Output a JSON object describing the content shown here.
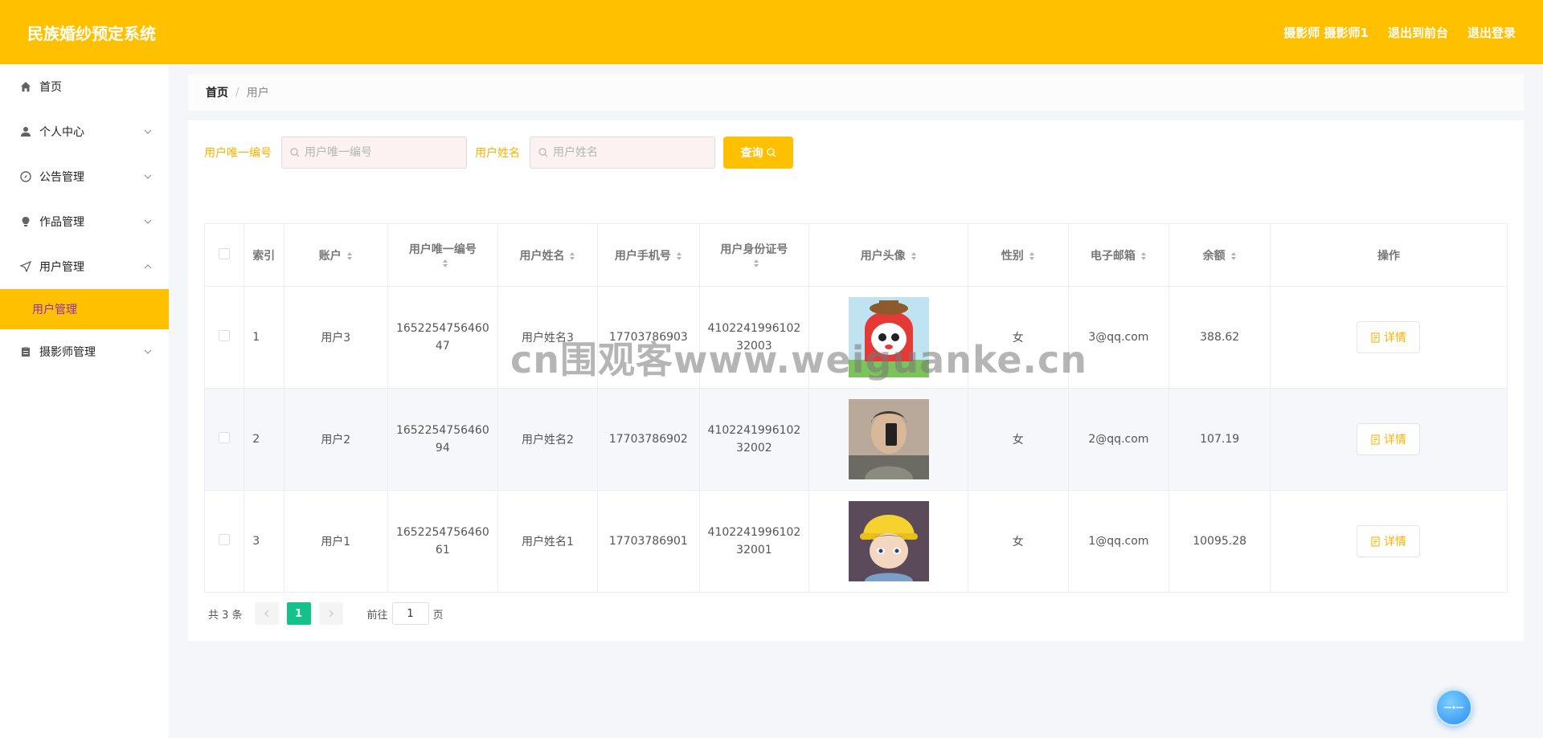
{
  "header": {
    "title": "民族婚纱预定系统",
    "user_label": "摄影师 摄影师1",
    "to_front": "退出到前台",
    "logout": "退出登录"
  },
  "sidebar": {
    "items": [
      {
        "label": "首页",
        "icon": "home-icon"
      },
      {
        "label": "个人中心",
        "icon": "user-icon"
      },
      {
        "label": "公告管理",
        "icon": "compass-icon"
      },
      {
        "label": "作品管理",
        "icon": "bulb-icon"
      },
      {
        "label": "用户管理",
        "icon": "send-icon"
      },
      {
        "label": "用户管理",
        "active": true
      },
      {
        "label": "摄影师管理",
        "icon": "clipboard-icon"
      }
    ]
  },
  "breadcrumb": {
    "home": "首页",
    "separator": "/",
    "current": "用户"
  },
  "search": {
    "uid_label": "用户唯一编号",
    "uid_placeholder": "用户唯一编号",
    "name_label": "用户姓名",
    "name_placeholder": "用户姓名",
    "button": "查询"
  },
  "table": {
    "headers": [
      "索引",
      "账户",
      "用户唯一编号",
      "用户姓名",
      "用户手机号",
      "用户身份证号",
      "用户头像",
      "性别",
      "电子邮箱",
      "余额",
      "操作"
    ],
    "rows": [
      {
        "index": "1",
        "account": "用户3",
        "uid": "1652254756460 47",
        "name": "用户姓名3",
        "phone": "17703786903",
        "idcard": "4102241996102 32003",
        "avatar": "cartoon-girl-avatar",
        "gender": "女",
        "email": "3@qq.com",
        "balance": "388.62",
        "action": "详情"
      },
      {
        "index": "2",
        "account": "用户2",
        "uid": "1652254756460 94",
        "name": "用户姓名2",
        "phone": "17703786902",
        "idcard": "4102241996102 32002",
        "avatar": "selfie-man-avatar",
        "gender": "女",
        "email": "2@qq.com",
        "balance": "107.19",
        "action": "详情"
      },
      {
        "index": "3",
        "account": "用户1",
        "uid": "1652254756460 61",
        "name": "用户姓名1",
        "phone": "17703786901",
        "idcard": "4102241996102 32001",
        "avatar": "anime-boy-avatar",
        "gender": "女",
        "email": "1@qq.com",
        "balance": "10095.28",
        "action": "详情"
      }
    ]
  },
  "pager": {
    "total": "共 3 条",
    "current_page": "1",
    "goto_label": "前往",
    "goto_value": "1",
    "page_suffix": "页"
  },
  "watermark": "cn围观客www.weiguanke.cn",
  "colors": {
    "accent": "#ffc000",
    "active_text": "#8d2fb9",
    "pager_active": "#13c28a"
  }
}
